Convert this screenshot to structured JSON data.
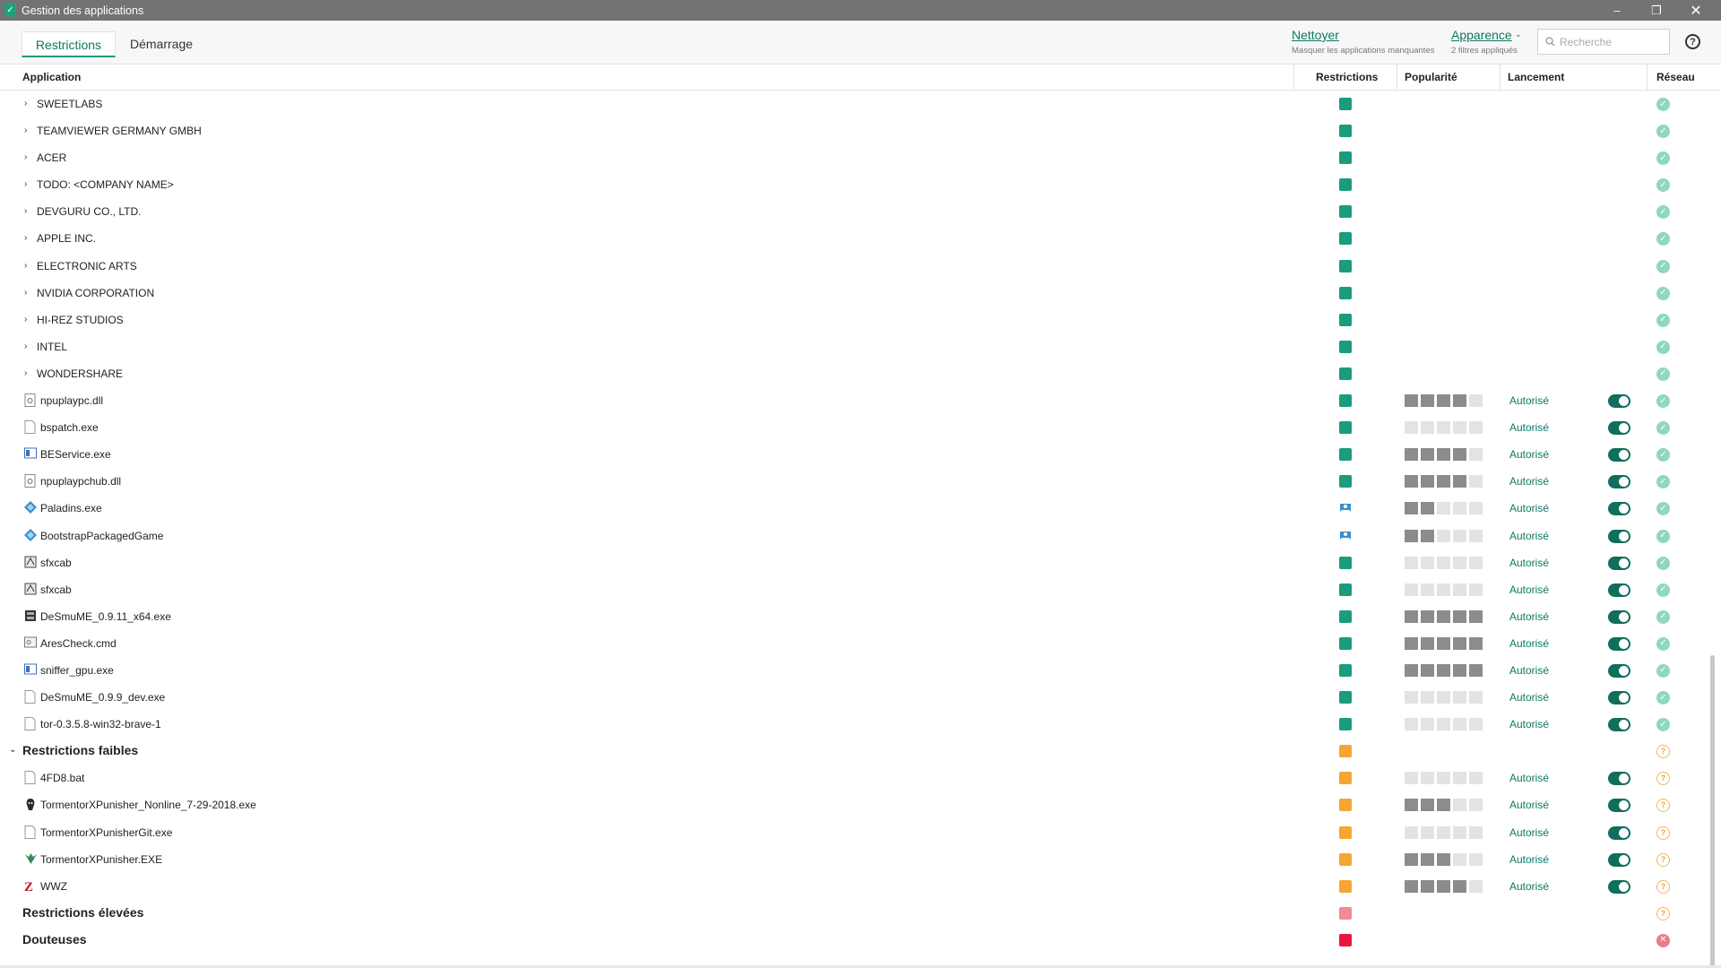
{
  "window": {
    "title": "Gestion des applications"
  },
  "tabs": [
    {
      "label": "Restrictions"
    },
    {
      "label": "Démarrage"
    }
  ],
  "toolbar": {
    "clean_label": "Nettoyer",
    "clean_sub": "Masquer les applications manquantes",
    "appearance_label": "Apparence",
    "appearance_sub": "2 filtres appliqués",
    "search_placeholder": "Recherche"
  },
  "columns": {
    "application": "Application",
    "restrictions": "Restrictions",
    "popularity": "Popularité",
    "launch": "Lancement",
    "network": "Réseau"
  },
  "colors": {
    "accent": "#1a9c7e",
    "trusted": "#1a9c7e",
    "low": "#f7a531",
    "high": "#f08a93",
    "doubtful": "#e8173d"
  },
  "rows": [
    {
      "kind": "category",
      "name": "SWEETLABS",
      "level": "trusted",
      "net": "ok"
    },
    {
      "kind": "category",
      "name": "TEAMVIEWER GERMANY GMBH",
      "level": "trusted",
      "net": "ok"
    },
    {
      "kind": "category",
      "name": "ACER",
      "level": "trusted",
      "net": "ok"
    },
    {
      "kind": "category",
      "name": "TODO: <COMPANY NAME>",
      "level": "trusted",
      "net": "ok"
    },
    {
      "kind": "category",
      "name": "DEVGURU CO., LTD.",
      "level": "trusted",
      "net": "ok"
    },
    {
      "kind": "category",
      "name": "APPLE INC.",
      "level": "trusted",
      "net": "ok"
    },
    {
      "kind": "category",
      "name": "ELECTRONIC ARTS",
      "level": "trusted",
      "net": "ok"
    },
    {
      "kind": "category",
      "name": "NVIDIA CORPORATION",
      "level": "trusted",
      "net": "ok"
    },
    {
      "kind": "category",
      "name": "HI-REZ STUDIOS",
      "level": "trusted",
      "net": "ok"
    },
    {
      "kind": "category",
      "name": "INTEL",
      "level": "trusted",
      "net": "ok"
    },
    {
      "kind": "category",
      "name": "WONDERSHARE",
      "level": "trusted",
      "net": "ok"
    },
    {
      "kind": "file",
      "name": "npuplaypc.dll",
      "icon": "dll-file-icon",
      "level": "trusted",
      "popularity": 4,
      "launch": "Autorisé",
      "net": "ok"
    },
    {
      "kind": "file",
      "name": "bspatch.exe",
      "icon": "blank-file-icon",
      "level": "trusted",
      "popularity": 0,
      "launch": "Autorisé",
      "net": "ok"
    },
    {
      "kind": "file",
      "name": "BEService.exe",
      "icon": "window-app-icon",
      "level": "trusted",
      "popularity": 4,
      "launch": "Autorisé",
      "net": "ok"
    },
    {
      "kind": "file",
      "name": "npuplaypchub.dll",
      "icon": "dll-file-icon",
      "level": "trusted",
      "popularity": 4,
      "launch": "Autorisé",
      "net": "ok"
    },
    {
      "kind": "file",
      "name": "Paladins.exe",
      "icon": "paladins-icon",
      "level": "user",
      "popularity": 2,
      "launch": "Autorisé",
      "net": "ok"
    },
    {
      "kind": "file",
      "name": "BootstrapPackagedGame",
      "icon": "paladins-icon",
      "level": "user",
      "popularity": 2,
      "launch": "Autorisé",
      "net": "ok"
    },
    {
      "kind": "file",
      "name": "sfxcab",
      "icon": "installer-icon",
      "level": "trusted",
      "popularity": 0,
      "launch": "Autorisé",
      "net": "ok"
    },
    {
      "kind": "file",
      "name": "sfxcab",
      "icon": "installer-icon",
      "level": "trusted",
      "popularity": 0,
      "launch": "Autorisé",
      "net": "ok"
    },
    {
      "kind": "file",
      "name": "DeSmuME_0.9.11_x64.exe",
      "icon": "desmume-icon",
      "level": "trusted",
      "popularity": 5,
      "launch": "Autorisé",
      "net": "ok"
    },
    {
      "kind": "file",
      "name": "AresCheck.cmd",
      "icon": "cmd-file-icon",
      "level": "trusted",
      "popularity": 5,
      "launch": "Autorisé",
      "net": "ok"
    },
    {
      "kind": "file",
      "name": "sniffer_gpu.exe",
      "icon": "window-app-icon",
      "level": "trusted",
      "popularity": 5,
      "launch": "Autorisé",
      "net": "ok"
    },
    {
      "kind": "file",
      "name": "DeSmuME_0.9.9_dev.exe",
      "icon": "blank-file-icon",
      "level": "trusted",
      "popularity": 0,
      "launch": "Autorisé",
      "net": "ok"
    },
    {
      "kind": "file",
      "name": "tor-0.3.5.8-win32-brave-1",
      "icon": "blank-file-icon",
      "level": "trusted",
      "popularity": 0,
      "launch": "Autorisé",
      "net": "ok"
    },
    {
      "kind": "group",
      "name": "Restrictions faibles",
      "level": "low",
      "net": "warn",
      "expanded": true
    },
    {
      "kind": "file",
      "name": "4FD8.bat",
      "icon": "blank-file-icon",
      "level": "low",
      "popularity": 0,
      "launch": "Autorisé",
      "net": "warn"
    },
    {
      "kind": "file",
      "name": "TormentorXPunisher_Nonline_7-29-2018.exe",
      "icon": "tormentor-icon",
      "level": "low",
      "popularity": 3,
      "launch": "Autorisé",
      "net": "warn"
    },
    {
      "kind": "file",
      "name": "TormentorXPunisherGit.exe",
      "icon": "blank-file-icon",
      "level": "low",
      "popularity": 0,
      "launch": "Autorisé",
      "net": "warn"
    },
    {
      "kind": "file",
      "name": "TormentorXPunisher.EXE",
      "icon": "tormentor-green-icon",
      "level": "low",
      "popularity": 3,
      "launch": "Autorisé",
      "net": "warn"
    },
    {
      "kind": "file",
      "name": "WWZ",
      "icon": "wwz-icon",
      "level": "low",
      "popularity": 4,
      "launch": "Autorisé",
      "net": "warn"
    },
    {
      "kind": "group",
      "name": "Restrictions élevées",
      "level": "high",
      "net": "warn",
      "expanded": false
    },
    {
      "kind": "group",
      "name": "Douteuses",
      "level": "doubtful",
      "net": "bad",
      "expanded": false
    }
  ]
}
